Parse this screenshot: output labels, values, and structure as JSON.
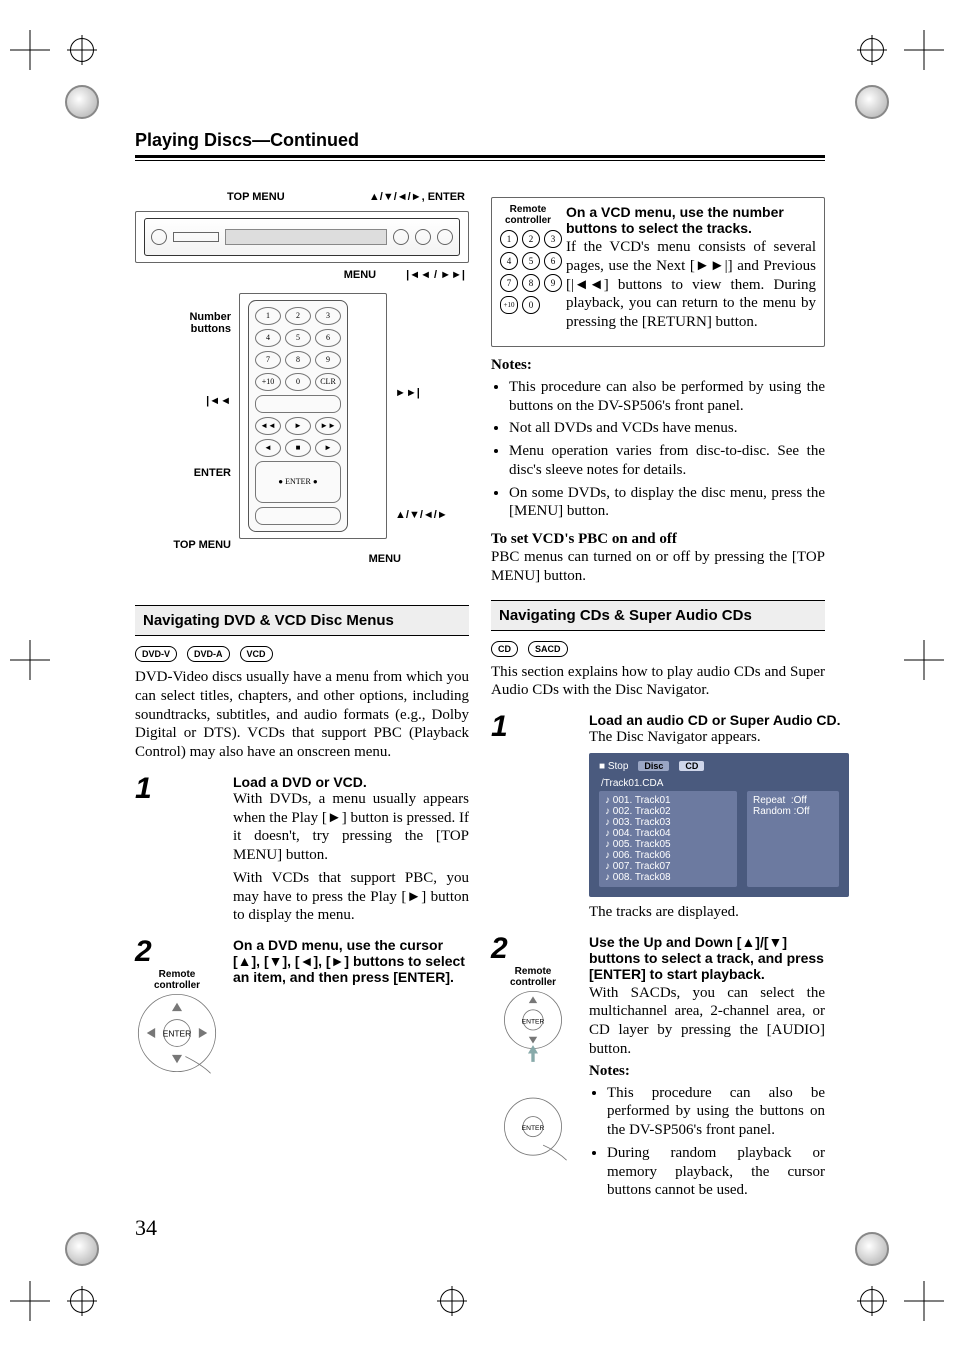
{
  "page_number": "34",
  "running_head": {
    "title": "Playing Discs",
    "continued": "—Continued"
  },
  "panel_callouts": {
    "top_menu": "TOP MENU",
    "cursor_enter": "▲/▼/◄/►, ENTER",
    "menu": "MENU",
    "prev_next": "|◄◄ / ►►|"
  },
  "remote_callouts": {
    "number_buttons": "Number\nbuttons",
    "prev": "|◄◄",
    "next": "►►|",
    "enter": "ENTER",
    "cursor": "▲/▼/◄/►",
    "top_menu": "TOP MENU",
    "menu": "MENU"
  },
  "dvd_section": {
    "title": "Navigating DVD & VCD Disc Menus",
    "badges": [
      "DVD-V",
      "DVD-A",
      "VCD"
    ],
    "intro": "DVD-Video discs usually have a menu from which you can select titles, chapters, and other options, including soundtracks, subtitles, and audio formats (e.g., Dolby Digital or DTS). VCDs that support PBC (Playback Control) may also have an onscreen menu.",
    "step1": {
      "num": "1",
      "heading": "Load a DVD or VCD.",
      "body1": "With DVDs, a menu usually appears when the Play [►] button is pressed. If it doesn't, try pressing the [TOP MENU] button.",
      "body2": "With VCDs that support PBC, you may have to press the Play [►] button to display the menu."
    },
    "step2": {
      "num": "2",
      "left_sub": "Remote\ncontroller",
      "heading": "On a DVD menu, use the cursor [▲], [▼], [◄], [►] buttons to select an item, and then press [ENTER]."
    }
  },
  "vcd_box": {
    "left_sub": "Remote\ncontroller",
    "keypad": [
      "1",
      "2",
      "3",
      "4",
      "5",
      "6",
      "7",
      "8",
      "9",
      "+10",
      "0"
    ],
    "heading": "On a VCD menu, use the number buttons to select the tracks.",
    "body": "If the VCD's menu consists of several pages, use the Next [►►|] and Previous [|◄◄] buttons to view them. During playback, you can return to the menu by pressing the [RETURN] button."
  },
  "notes_heading": "Notes:",
  "notes": [
    "This procedure can also be performed by using the buttons on the DV-SP506's front panel.",
    "Not all DVDs and VCDs have menus.",
    "Menu operation varies from disc-to-disc. See the disc's sleeve notes for details.",
    "On some DVDs, to display the disc menu, press the [MENU] button."
  ],
  "pbc": {
    "heading": "To set VCD's PBC on and off",
    "body": "PBC menus can turned on or off by pressing the [TOP MENU] button."
  },
  "cd_section": {
    "title": "Navigating CDs & Super Audio CDs",
    "badges": [
      "CD",
      "SACD"
    ],
    "intro": "This section explains how to play audio CDs and Super Audio CDs with the Disc Navigator.",
    "step1": {
      "num": "1",
      "heading": "Load an audio CD or Super Audio CD.",
      "body1": "The Disc Navigator appears.",
      "screen": {
        "status": "■ Stop",
        "disc_label": "Disc",
        "disc_val": "CD",
        "path": "/Track01.CDA",
        "tracks": [
          "001. Track01",
          "002. Track02",
          "003. Track03",
          "004. Track04",
          "005. Track05",
          "006. Track06",
          "007. Track07",
          "008. Track08"
        ],
        "side": [
          {
            "k": "Repeat",
            "v": ":Off"
          },
          {
            "k": "Random",
            "v": ":Off"
          }
        ]
      },
      "body2": "The tracks are displayed."
    },
    "step2": {
      "num": "2",
      "left_sub": "Remote\ncontroller",
      "heading": "Use the Up and Down [▲]/[▼] buttons to select a track, and press [ENTER] to start playback.",
      "body1": "With SACDs, you can select the multichannel area, 2-channel area, or CD layer by pressing the [AUDIO] button.",
      "notes_heading": "Notes:",
      "notes": [
        "This procedure can also be performed by using the buttons on the DV-SP506's front panel.",
        "During random playback or memory playback, the cursor buttons cannot be used."
      ]
    }
  }
}
